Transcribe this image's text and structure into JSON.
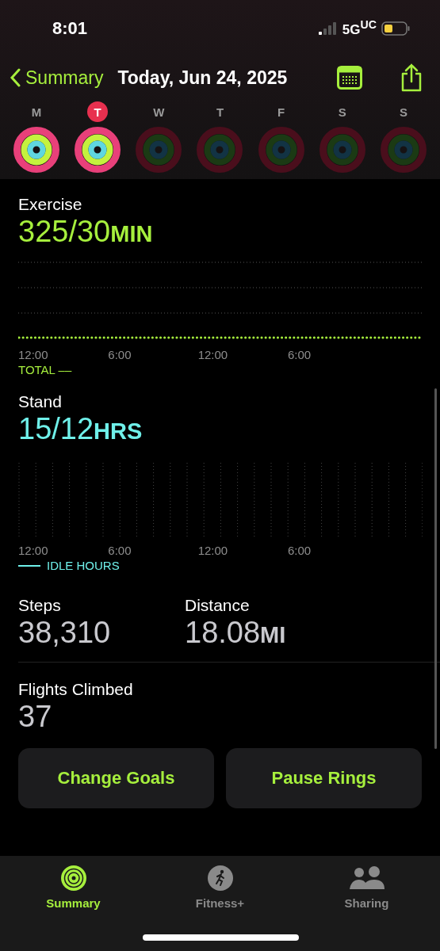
{
  "status_bar": {
    "time": "8:01",
    "network": "5G$^{UC}$"
  },
  "nav": {
    "back_label": "Summary",
    "title": "Today, Jun 24, 2025"
  },
  "days": [
    {
      "label": "M",
      "selected": false,
      "completed": true
    },
    {
      "label": "T",
      "selected": true,
      "completed": true
    },
    {
      "label": "W",
      "selected": false,
      "completed": false
    },
    {
      "label": "T",
      "selected": false,
      "completed": false
    },
    {
      "label": "F",
      "selected": false,
      "completed": false
    },
    {
      "label": "S",
      "selected": false,
      "completed": false
    },
    {
      "label": "S",
      "selected": false,
      "completed": false
    }
  ],
  "sections": [
    {
      "kind": "exercise",
      "title": "Exercise",
      "value": "325/30",
      "unit": "MIN",
      "axis_labels": [
        "12:00",
        "6:00",
        "12:00",
        "6:00"
      ],
      "legend": "TOTAL ––"
    },
    {
      "kind": "stand",
      "title": "Stand",
      "value": "15/12",
      "unit": "HRS",
      "axis_labels": [
        "12:00",
        "6:00",
        "12:00",
        "6:00"
      ],
      "legend": "IDLE HOURS"
    }
  ],
  "stats": [
    {
      "label": "Steps",
      "value": "38,310"
    },
    {
      "label": "Distance",
      "value": "18.08",
      "unit": "MI"
    }
  ],
  "flights": {
    "label": "Flights Climbed",
    "value": "37"
  },
  "buttons": [
    "Change Goals",
    "Pause Rings"
  ],
  "tabs": [
    {
      "label": "Summary",
      "selected": true,
      "kind": "rings"
    },
    {
      "label": "Fitness+",
      "selected": false,
      "kind": "runner"
    },
    {
      "label": "Sharing",
      "selected": false,
      "kind": "people"
    }
  ]
}
